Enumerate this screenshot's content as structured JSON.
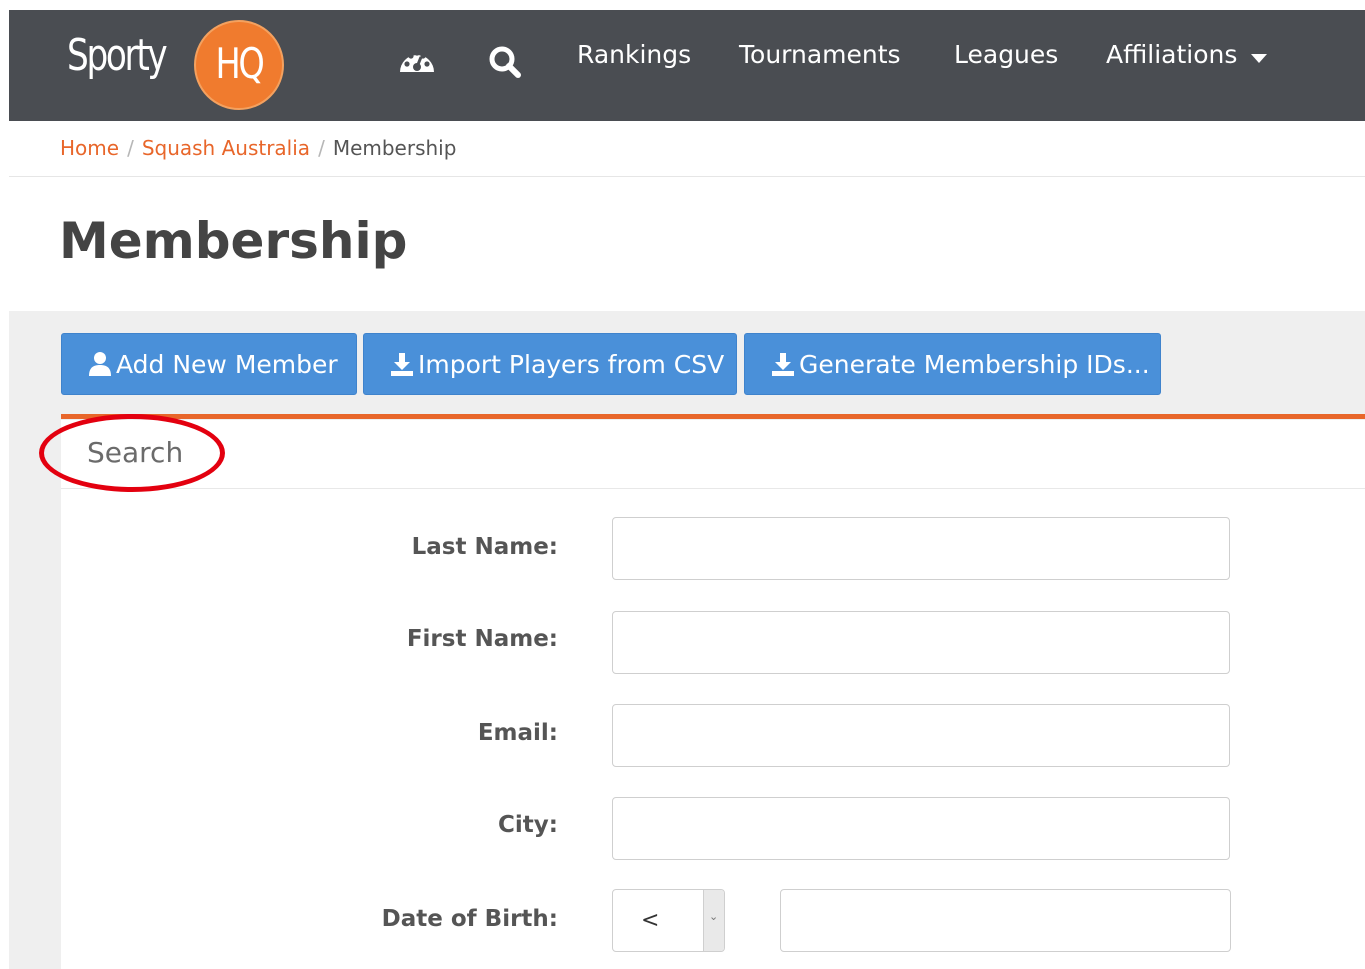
{
  "brand": {
    "sporty": "Sporty",
    "hq": "HQ",
    "hq_color": "#f07b2e"
  },
  "nav": {
    "background": "#4a4d52",
    "icons": [
      "dashboard-icon",
      "search-icon"
    ],
    "links": [
      "Rankings",
      "Tournaments",
      "Leagues",
      "Affiliations"
    ]
  },
  "breadcrumb": {
    "home": "Home",
    "org": "Squash Australia",
    "current": "Membership"
  },
  "page": {
    "title": "Membership"
  },
  "actions": {
    "add_member": "Add New Member",
    "import_csv": "Import Players from CSV",
    "generate_ids": "Generate Membership IDs...",
    "button_color": "#4a90d9"
  },
  "search": {
    "heading": "Search",
    "accent": "#e8662a",
    "annotation_color": "#e3000f",
    "fields": {
      "last_name": "Last Name:",
      "first_name": "First Name:",
      "email": "Email:",
      "city": "City:",
      "dob": "Date of Birth:"
    },
    "dob_operator": "<"
  }
}
